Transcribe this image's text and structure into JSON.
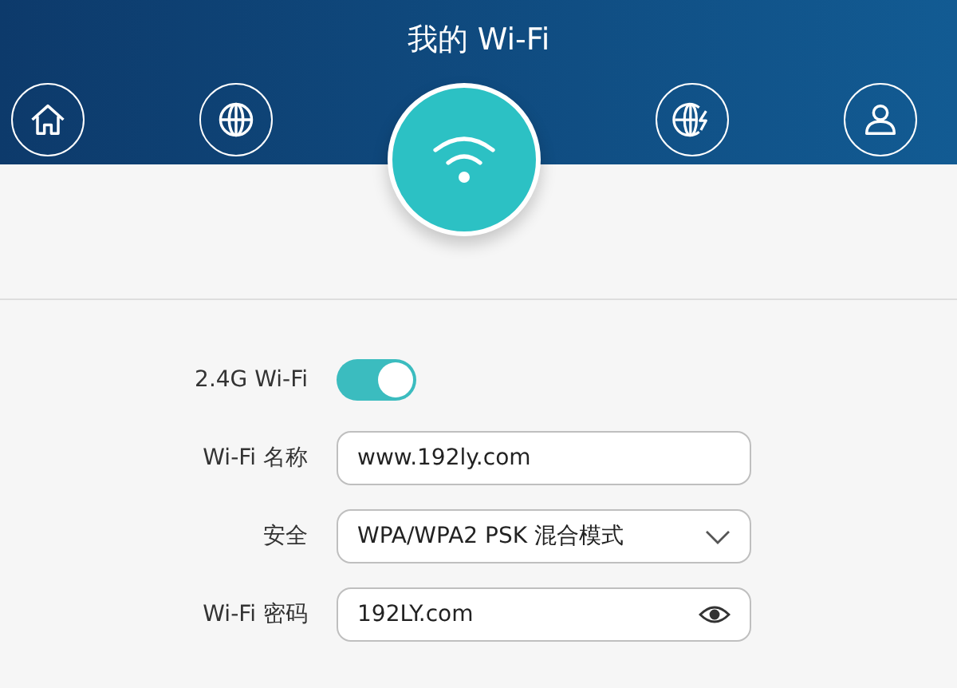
{
  "header": {
    "title": "我的 Wi-Fi"
  },
  "nav": [
    {
      "kind": "home",
      "selected": false
    },
    {
      "kind": "globe",
      "selected": false
    },
    {
      "kind": "wifi",
      "selected": true
    },
    {
      "kind": "globe-bolt",
      "selected": false
    },
    {
      "kind": "user",
      "selected": false
    }
  ],
  "settings": [
    {
      "kind": "toggle",
      "label": "2.4G Wi-Fi",
      "on": true
    },
    {
      "kind": "text",
      "label": "Wi-Fi 名称",
      "value": "www.192ly.com"
    },
    {
      "kind": "select",
      "label": "安全",
      "value": "WPA/WPA2 PSK 混合模式"
    },
    {
      "kind": "password",
      "label": "Wi-Fi 密码",
      "value": "192LY.com"
    }
  ]
}
